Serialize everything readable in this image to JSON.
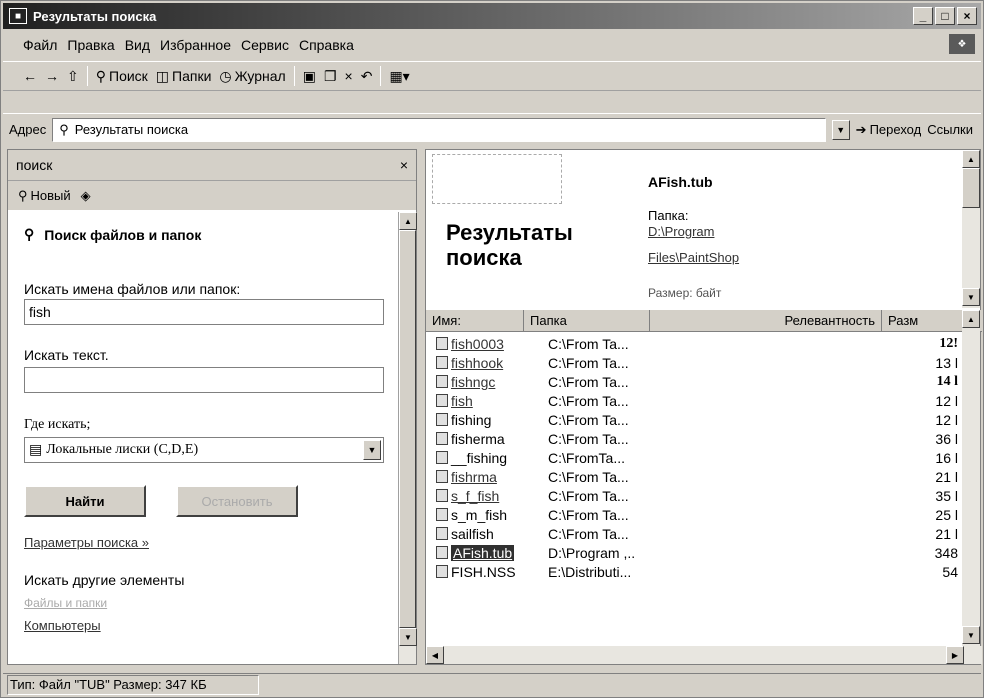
{
  "window": {
    "title": "Результаты поиска"
  },
  "menu": [
    "Файл",
    "Правка",
    "Вид",
    "Избранное",
    "Сервис",
    "Справка"
  ],
  "toolbar": {
    "search": "Поиск",
    "folders": "Папки",
    "history": "Журнал"
  },
  "address": {
    "label": "Адрес",
    "value": "Результаты поиска",
    "go": "Переход",
    "links": "Ссылки"
  },
  "search_pane": {
    "header": "поиск",
    "new_label": "Новый",
    "section_title": "Поиск файлов и папок",
    "names_label": "Искать имена файлов или папок:",
    "names_value": "fish",
    "text_label": "Искать текст.",
    "text_value": "",
    "where_label": "Где искать;",
    "where_value": "Локальные лиски (C,D,E)",
    "find_btn": "Найти",
    "stop_btn": "Остановить",
    "params_link": "Параметры поиска »",
    "other_label": "Искать другие элементы",
    "other_files": "Файлы и папки",
    "computers": "Компьютеры"
  },
  "preview": {
    "heading": "Результаты поиска",
    "file_name": "AFish.tub",
    "folder_label": "Папка:",
    "folder_link1": "D:\\Program",
    "folder_link2": "Files\\PaintShop",
    "size_label": "Размер: байт"
  },
  "columns": {
    "name": "Имя:",
    "folder": "Папка",
    "relevance": "Релевантность",
    "size": "Разм"
  },
  "files": [
    {
      "name": "fish0003",
      "folder": "C:\\From Ta...",
      "size": "12!"
    },
    {
      "name": "fishhook",
      "folder": "C:\\From Ta...",
      "size": "13 l"
    },
    {
      "name": "fishngc",
      "folder": "C:\\From Ta...",
      "size": "14 l"
    },
    {
      "name": "fish",
      "folder": "C:\\From Ta...",
      "size": "12 l"
    },
    {
      "name": "fishing",
      "folder": "C:\\From Ta...",
      "size": "12 l"
    },
    {
      "name": "fisherma",
      "folder": "C:\\From Ta...",
      "size": "36 l"
    },
    {
      "name": "__fishing",
      "folder": "C:\\FromTa...",
      "size": "16 l"
    },
    {
      "name": "fishrma",
      "folder": "C:\\From Ta...",
      "size": "21 l"
    },
    {
      "name": "s_f_fish",
      "folder": "C:\\From Ta...",
      "size": "35 l"
    },
    {
      "name": "s_m_fish",
      "folder": "C:\\From Ta...",
      "size": "25 l"
    },
    {
      "name": "sailfish",
      "folder": "C:\\From Ta...",
      "size": "21 l"
    },
    {
      "name": "AFish.tub",
      "folder": "D:\\Program ,..",
      "size": "348"
    },
    {
      "name": "FISH.NSS",
      "folder": "E:\\Distributi...",
      "size": "54"
    }
  ],
  "status": {
    "text": "Тип: Файл \"TUB\" Размер: 347 КБ"
  }
}
